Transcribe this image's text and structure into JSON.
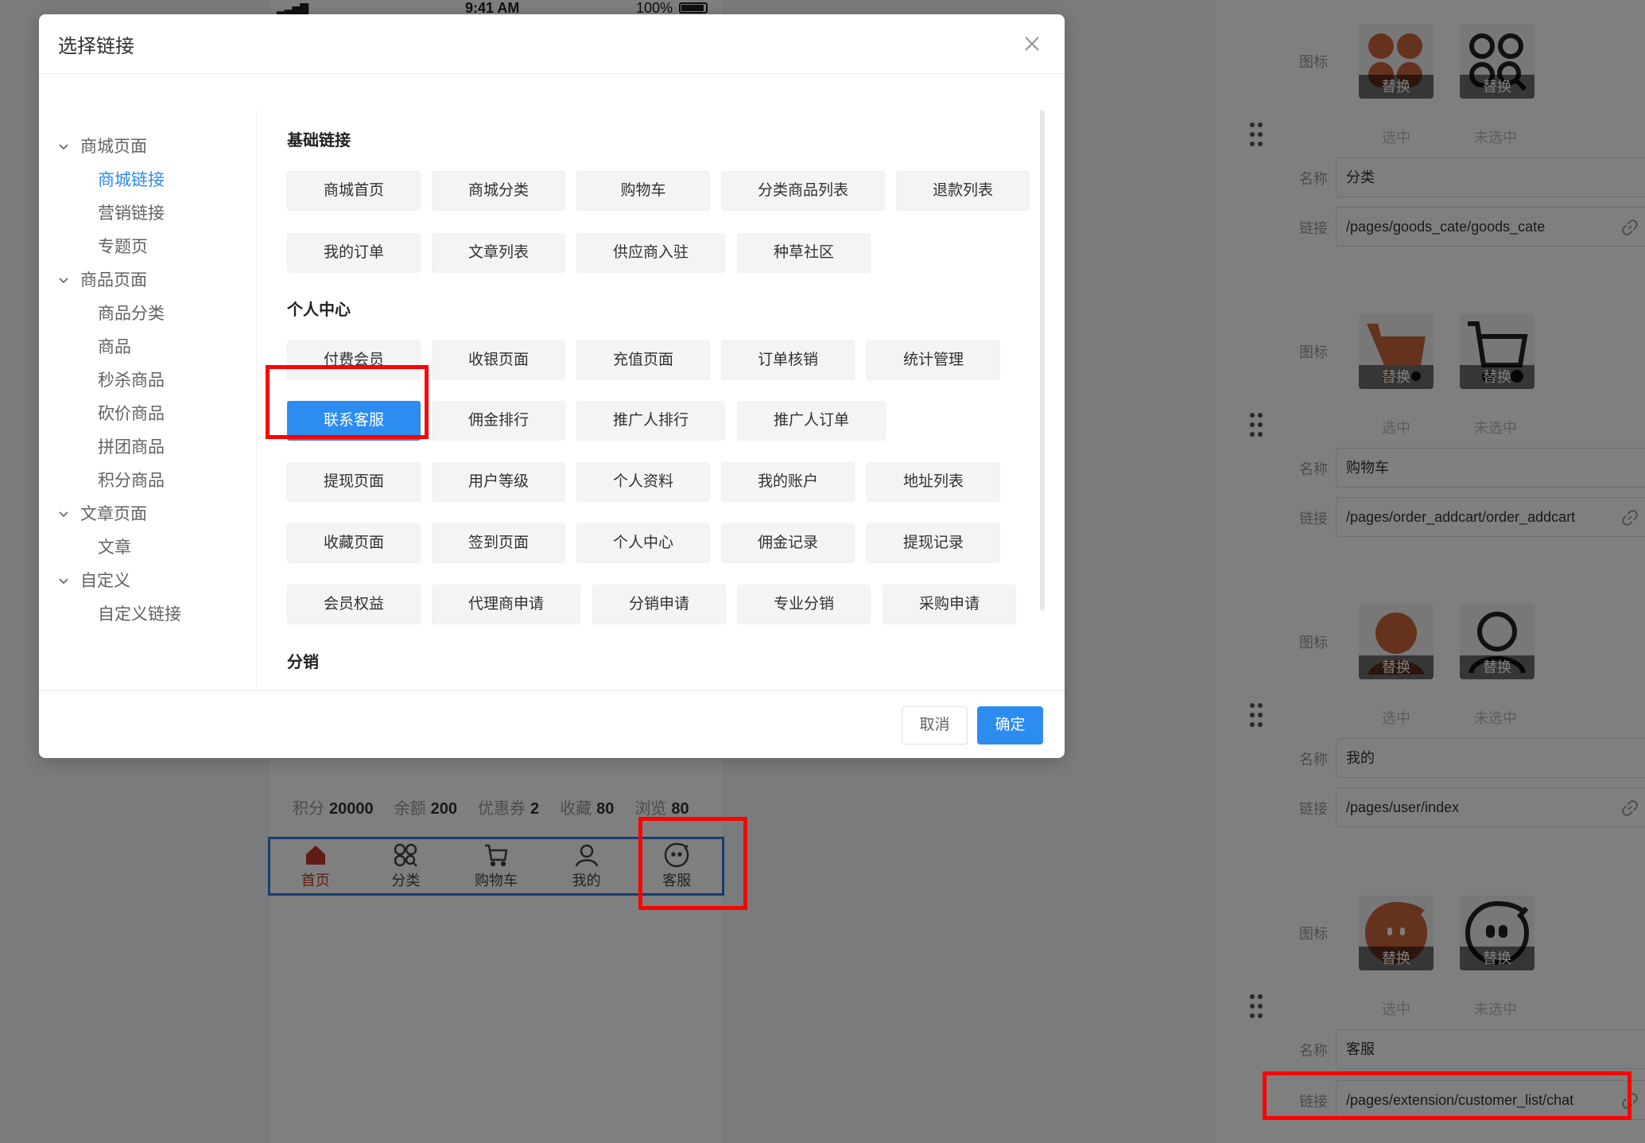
{
  "statusbar": {
    "signal": "▂▃▅▇",
    "time": "9:41 AM",
    "battery": "100%"
  },
  "stats": [
    {
      "label": "积分",
      "value": "20000"
    },
    {
      "label": "余额",
      "value": "200"
    },
    {
      "label": "优惠券",
      "value": "2"
    },
    {
      "label": "收藏",
      "value": "80"
    },
    {
      "label": "浏览",
      "value": "80"
    }
  ],
  "tabbar": {
    "items": [
      {
        "label": "首页",
        "icon": "home-icon",
        "active": true
      },
      {
        "label": "分类",
        "icon": "category-icon",
        "active": false
      },
      {
        "label": "购物车",
        "icon": "cart-icon",
        "active": false
      },
      {
        "label": "我的",
        "icon": "user-icon",
        "active": false
      },
      {
        "label": "客服",
        "icon": "chat-icon",
        "active": false
      }
    ]
  },
  "right_panel": {
    "icon_label": "图标",
    "name_label": "名称",
    "link_label": "链接",
    "replace_label": "替换",
    "selected_label": "选中",
    "unselected_label": "未选中",
    "groups": [
      {
        "name": "分类",
        "link": "/pages/goods_cate/goods_cate",
        "icon": "category-icon"
      },
      {
        "name": "购物车",
        "link": "/pages/order_addcart/order_addcart",
        "icon": "cart-icon"
      },
      {
        "name": "我的",
        "link": "/pages/user/index",
        "icon": "user-icon"
      },
      {
        "name": "客服",
        "link": "/pages/extension/customer_list/chat",
        "icon": "chat-icon"
      }
    ],
    "accent_color": "#c8653a"
  },
  "dialog": {
    "title": "选择链接",
    "cancel": "取消",
    "confirm": "确定",
    "tree": [
      {
        "label": "商城页面",
        "children": [
          "商城链接",
          "营销链接",
          "专题页"
        ]
      },
      {
        "label": "商品页面",
        "children": [
          "商品分类",
          "商品",
          "秒杀商品",
          "砍价商品",
          "拼团商品",
          "积分商品"
        ]
      },
      {
        "label": "文章页面",
        "children": [
          "文章"
        ]
      },
      {
        "label": "自定义",
        "children": [
          "自定义链接"
        ]
      }
    ],
    "selected_tree_item": "商城链接",
    "sections": [
      {
        "title": "基础链接",
        "rows": [
          [
            "商城首页",
            "商城分类",
            "购物车",
            "分类商品列表",
            "退款列表"
          ],
          [
            "我的订单",
            "文章列表",
            "供应商入驻",
            "种草社区"
          ]
        ]
      },
      {
        "title": "个人中心",
        "rows": [
          [
            "付费会员",
            "收银页面",
            "充值页面",
            "订单核销",
            "统计管理"
          ],
          [
            "联系客服",
            "佣金排行",
            "推广人排行",
            "推广人订单"
          ],
          [
            "提现页面",
            "用户等级",
            "个人资料",
            "我的账户",
            "地址列表"
          ],
          [
            "收藏页面",
            "签到页面",
            "个人中心",
            "佣金记录",
            "提现记录"
          ],
          [
            "会员权益",
            "代理商申请",
            "分销申请",
            "专业分销",
            "采购申请"
          ]
        ]
      },
      {
        "title": "分销",
        "rows": []
      }
    ],
    "selected_link": "联系客服",
    "primary_color": "#2d8cf0"
  }
}
